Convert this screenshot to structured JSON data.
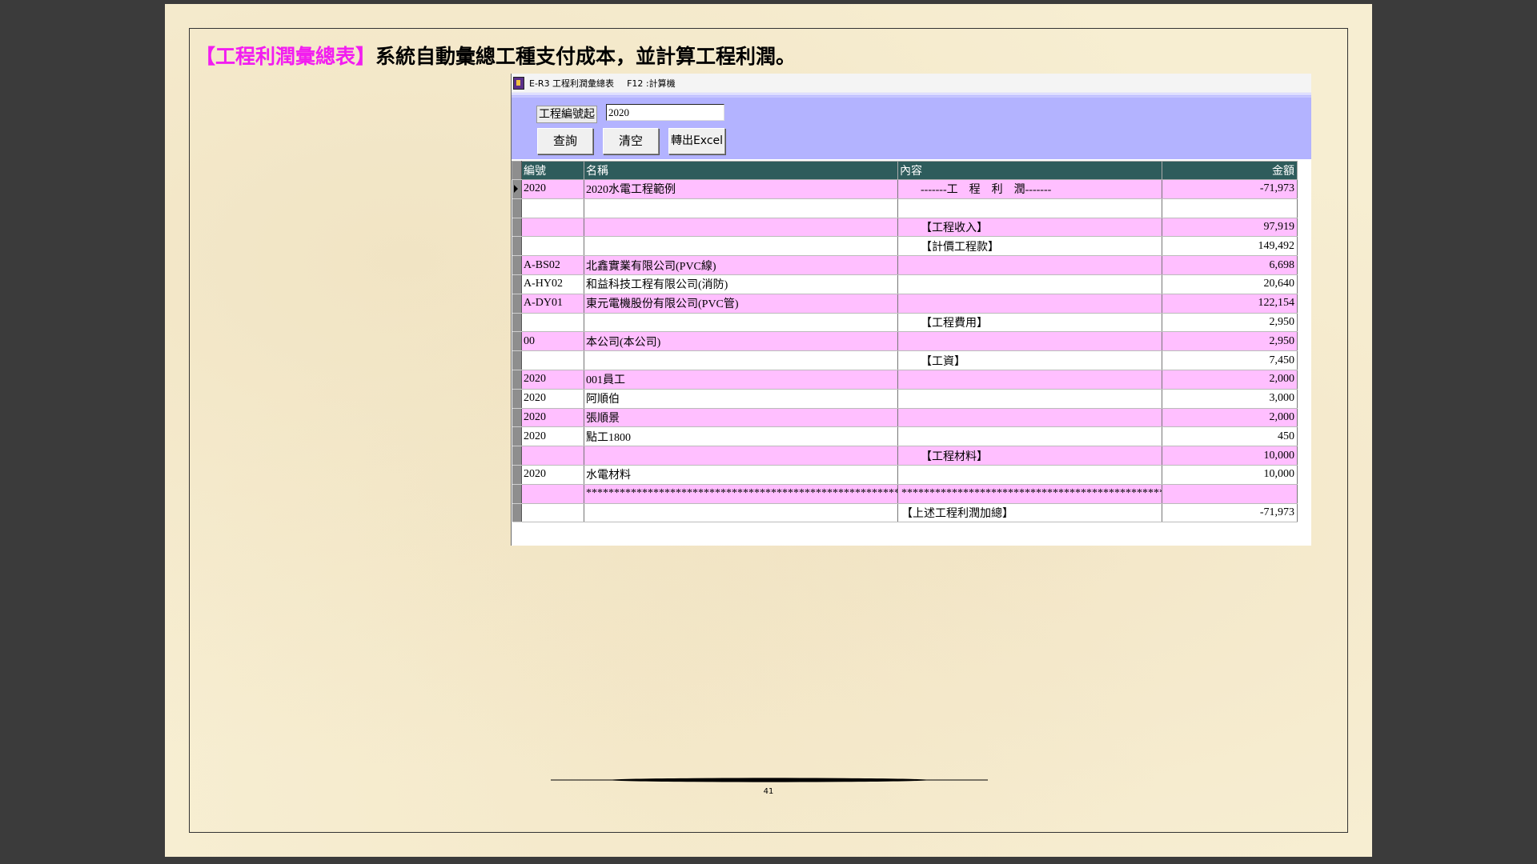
{
  "heading": {
    "highlight": "【工程利潤彙總表】",
    "text": "系統自動彙總工種支付成本，並計算工程利潤。"
  },
  "window": {
    "title": "E-R3 工程利潤彙總表",
    "shortcut": "F12 :計算機"
  },
  "filter": {
    "label": "工程編號起",
    "value": "2020"
  },
  "buttons": {
    "query": "查詢",
    "clear": "清空",
    "export": "轉出Excel"
  },
  "columns": {
    "code": "編號",
    "name": "名稱",
    "content": "內容",
    "amount": "金額"
  },
  "rows": [
    {
      "code": "2020",
      "name": "2020水電工程範例",
      "content": "-------工　程　利　潤-------",
      "amount": "-71,973"
    },
    {
      "code": "",
      "name": "",
      "content": "",
      "amount": ""
    },
    {
      "code": "",
      "name": "",
      "content": "【工程收入】",
      "amount": "97,919"
    },
    {
      "code": "",
      "name": "",
      "content": "【計價工程款】",
      "amount": "149,492"
    },
    {
      "code": "A-BS02",
      "name": "北鑫實業有限公司(PVC線)",
      "content": "",
      "amount": "6,698"
    },
    {
      "code": "A-HY02",
      "name": "和益科技工程有限公司(消防)",
      "content": "",
      "amount": "20,640"
    },
    {
      "code": "A-DY01",
      "name": "東元電機股份有限公司(PVC管)",
      "content": "",
      "amount": "122,154"
    },
    {
      "code": "",
      "name": "",
      "content": "【工程費用】",
      "amount": "2,950"
    },
    {
      "code": "00",
      "name": "本公司(本公司)",
      "content": "",
      "amount": "2,950"
    },
    {
      "code": "",
      "name": "",
      "content": "【工資】",
      "amount": "7,450"
    },
    {
      "code": "2020",
      "name": "001員工",
      "content": "",
      "amount": "2,000"
    },
    {
      "code": "2020",
      "name": "阿順伯",
      "content": "",
      "amount": "3,000"
    },
    {
      "code": "2020",
      "name": "張順景",
      "content": "",
      "amount": "2,000"
    },
    {
      "code": "2020",
      "name": "點工1800",
      "content": "",
      "amount": "450"
    },
    {
      "code": "",
      "name": "",
      "content": "【工程材料】",
      "amount": "10,000"
    },
    {
      "code": "2020",
      "name": "水電材料",
      "content": "",
      "amount": "10,000"
    },
    {
      "code": "",
      "name": "***********************************************************************",
      "content": "*************************************************************",
      "amount": ""
    },
    {
      "code": "",
      "name": "",
      "content": "【上述工程利潤加總】",
      "amount": "-71,973"
    }
  ],
  "page_number": "41"
}
